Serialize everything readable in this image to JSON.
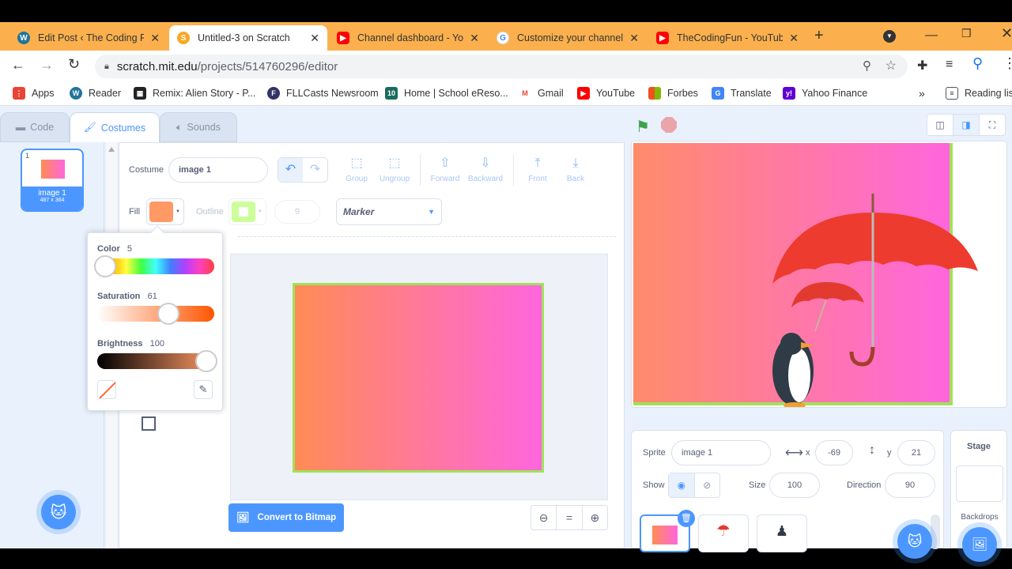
{
  "tabs": [
    {
      "label": "Edit Post ‹ The Coding Fu",
      "icon": "wordpress-icon",
      "color": "#21759b"
    },
    {
      "label": "Untitled-3 on Scratch",
      "icon": "scratch-icon",
      "color": "#f9a825"
    },
    {
      "label": "Channel dashboard - Yo",
      "icon": "youtube-icon",
      "color": "#ff0000"
    },
    {
      "label": "Customize your channel",
      "icon": "google-icon",
      "color": "#4285f4"
    },
    {
      "label": "TheCodingFun - YouTub",
      "icon": "youtube-icon",
      "color": "#ff0000"
    }
  ],
  "url": {
    "host": "scratch.mit.edu",
    "path": "/projects/514760296/editor"
  },
  "bookmarks": [
    {
      "label": "Apps",
      "color": "#ea4335",
      "glyph": "⋮"
    },
    {
      "label": "Reader",
      "color": "#21759b",
      "glyph": "W"
    },
    {
      "label": "Remix: Alien Story - P...",
      "color": "#222222",
      "glyph": "▦"
    },
    {
      "label": "FLLCasts Newsroom",
      "color": "#333366",
      "glyph": "F"
    },
    {
      "label": "Home | School eReso...",
      "color": "#1a6b5e",
      "glyph": "10"
    },
    {
      "label": "Gmail",
      "color": "#ea4335",
      "glyph": "M"
    },
    {
      "label": "YouTube",
      "color": "#ff0000",
      "glyph": "▶"
    },
    {
      "label": "Forbes",
      "color": "#34a853",
      "glyph": "▦"
    },
    {
      "label": "Translate",
      "color": "#4285f4",
      "glyph": "G"
    },
    {
      "label": "Yahoo Finance",
      "color": "#6001d2",
      "glyph": "y!"
    }
  ],
  "bookmarks_more": "»",
  "reading_list": "Reading list",
  "editor_tabs": {
    "code": "Code",
    "costumes": "Costumes",
    "sounds": "Sounds"
  },
  "costume_list": [
    {
      "index": "1",
      "name": "image 1",
      "size": "487 x 364"
    }
  ],
  "costume": {
    "label": "Costume",
    "name": "image 1",
    "tools": [
      "Group",
      "Ungroup",
      "Forward",
      "Backward",
      "Front",
      "Back"
    ],
    "fill_label": "Fill",
    "fill_color": "#ff9966",
    "outline_label": "Outline",
    "outline_color": "#ccff99",
    "outline_width": "9",
    "brush_mode": "Marker",
    "convert_button": "Convert to Bitmap"
  },
  "color_picker": {
    "color_label": "Color",
    "color_value": "5",
    "color_pos": 0.05,
    "saturation_label": "Saturation",
    "saturation_value": "61",
    "saturation_pos": 0.61,
    "brightness_label": "Brightness",
    "brightness_value": "100",
    "brightness_pos": 1.0
  },
  "sprite_info": {
    "sprite_label": "Sprite",
    "sprite_name": "image 1",
    "x_label": "x",
    "x": "-69",
    "y_label": "y",
    "y": "21",
    "show_label": "Show",
    "size_label": "Size",
    "size": "100",
    "direction_label": "Direction",
    "direction": "90"
  },
  "stage_panel": {
    "title": "Stage",
    "backdrops_label": "Backdrops"
  },
  "colors": {
    "accent": "#4c97ff",
    "scratch_bg": "#e9f1fc",
    "tabbar": "#fbb04d",
    "stage_pink": "#ff66dd",
    "stage_orange": "#ff8c55",
    "outline_green": "#a3e05b"
  }
}
